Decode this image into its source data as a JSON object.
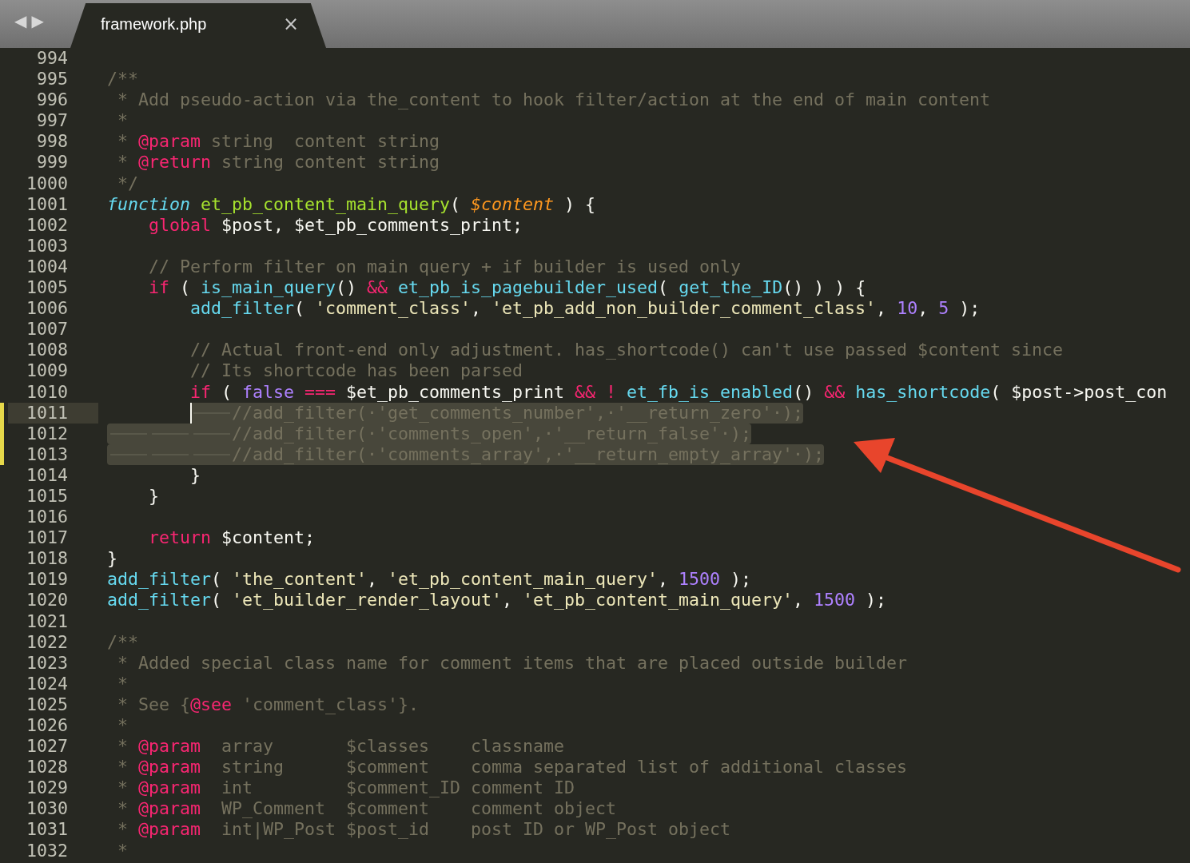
{
  "tab_bar": {
    "back": "◀",
    "forward": "▶",
    "tabs": [
      {
        "label": "framework.php",
        "close": "×",
        "selected": true
      }
    ]
  },
  "editor": {
    "lines": [
      {
        "number": "994",
        "current": false,
        "modified": false,
        "selected": false
      },
      {
        "number": "995",
        "current": false,
        "modified": false,
        "selected": false,
        "tokens": [
          {
            "kind": "comment",
            "text": "/**"
          }
        ]
      },
      {
        "number": "996",
        "current": false,
        "modified": false,
        "selected": false,
        "tokens": [
          {
            "kind": "comment",
            "text": " * Add pseudo-action via the_content to hook filter/action at the end of main content"
          }
        ]
      },
      {
        "number": "997",
        "current": false,
        "modified": false,
        "selected": false,
        "tokens": [
          {
            "kind": "comment",
            "text": " *"
          }
        ]
      },
      {
        "number": "998",
        "current": false,
        "modified": false,
        "selected": false,
        "tokens": [
          {
            "kind": "comment",
            "text": " * "
          },
          {
            "kind": "tag",
            "text": "@param"
          },
          {
            "kind": "comment",
            "text": " string  content string"
          }
        ]
      },
      {
        "number": "999",
        "current": false,
        "modified": false,
        "selected": false,
        "tokens": [
          {
            "kind": "comment",
            "text": " * "
          },
          {
            "kind": "tag",
            "text": "@return"
          },
          {
            "kind": "comment",
            "text": " string content string"
          }
        ]
      },
      {
        "number": "1000",
        "current": false,
        "modified": false,
        "selected": false,
        "tokens": [
          {
            "kind": "comment",
            "text": " */"
          }
        ]
      },
      {
        "number": "1001",
        "current": false,
        "modified": false,
        "selected": false,
        "tokens": [
          {
            "kind": "storage",
            "text": "function"
          },
          {
            "kind": "entity",
            "text": " et_pb_content_main_query"
          },
          {
            "kind": "plain",
            "text": "( "
          },
          {
            "kind": "param",
            "text": "$content"
          },
          {
            "kind": "plain",
            "text": " ) {"
          }
        ]
      },
      {
        "number": "1002",
        "current": false,
        "modified": false,
        "selected": false,
        "tokens": [
          {
            "kind": "keyword",
            "text": "\tglobal"
          },
          {
            "kind": "plain",
            "text": " $post, $et_pb_comments_print;"
          }
        ]
      },
      {
        "number": "1003",
        "current": false,
        "modified": false,
        "selected": false
      },
      {
        "number": "1004",
        "current": false,
        "modified": false,
        "selected": false,
        "tokens": [
          {
            "kind": "comment",
            "text": "\t// Perform filter on main query + if builder is used only"
          }
        ]
      },
      {
        "number": "1005",
        "current": false,
        "modified": false,
        "selected": false,
        "tokens": [
          {
            "kind": "keyword",
            "text": "\tif"
          },
          {
            "kind": "plain",
            "text": " ( "
          },
          {
            "kind": "call",
            "text": "is_main_query"
          },
          {
            "kind": "plain",
            "text": "() "
          },
          {
            "kind": "keyword",
            "text": "&&"
          },
          {
            "kind": "call",
            "text": " et_pb_is_pagebuilder_used"
          },
          {
            "kind": "plain",
            "text": "( "
          },
          {
            "kind": "call",
            "text": "get_the_ID"
          },
          {
            "kind": "plain",
            "text": "() ) ) {"
          }
        ]
      },
      {
        "number": "1006",
        "current": false,
        "modified": false,
        "selected": false,
        "tokens": [
          {
            "kind": "call",
            "text": "\t\tadd_filter"
          },
          {
            "kind": "plain",
            "text": "( "
          },
          {
            "kind": "string",
            "text": "'comment_class'"
          },
          {
            "kind": "plain",
            "text": ", "
          },
          {
            "kind": "string",
            "text": "'et_pb_add_non_builder_comment_class'"
          },
          {
            "kind": "plain",
            "text": ", "
          },
          {
            "kind": "number",
            "text": "10"
          },
          {
            "kind": "plain",
            "text": ", "
          },
          {
            "kind": "number",
            "text": "5"
          },
          {
            "kind": "plain",
            "text": " );"
          }
        ]
      },
      {
        "number": "1007",
        "current": false,
        "modified": false,
        "selected": false
      },
      {
        "number": "1008",
        "current": false,
        "modified": false,
        "selected": false,
        "tokens": [
          {
            "kind": "comment",
            "text": "\t\t// Actual front-end only adjustment. has_shortcode() can't use passed $content since"
          }
        ]
      },
      {
        "number": "1009",
        "current": false,
        "modified": false,
        "selected": false,
        "tokens": [
          {
            "kind": "comment",
            "text": "\t\t// Its shortcode has been parsed"
          }
        ]
      },
      {
        "number": "1010",
        "current": false,
        "modified": false,
        "selected": false,
        "tokens": [
          {
            "kind": "keyword",
            "text": "\t\tif"
          },
          {
            "kind": "plain",
            "text": " ( "
          },
          {
            "kind": "constant",
            "text": "false"
          },
          {
            "kind": "keyword",
            "text": " ==="
          },
          {
            "kind": "plain",
            "text": " $et_pb_comments_print "
          },
          {
            "kind": "keyword",
            "text": "&& !"
          },
          {
            "kind": "call",
            "text": " et_fb_is_enabled"
          },
          {
            "kind": "plain",
            "text": "() "
          },
          {
            "kind": "keyword",
            "text": "&&"
          },
          {
            "kind": "call",
            "text": " has_shortcode"
          },
          {
            "kind": "plain",
            "text": "( $post->post_con"
          }
        ]
      },
      {
        "number": "1011",
        "current": true,
        "modified": true,
        "selected": true,
        "tokens": [
          {
            "kind": "comment",
            "text": "\t\t\t//add_filter(·'get_comments_number',·'__return_zero'·);"
          }
        ]
      },
      {
        "number": "1012",
        "current": false,
        "modified": true,
        "selected": true,
        "tokens": [
          {
            "kind": "comment",
            "text": "\t\t\t//add_filter(·'comments_open',·'__return_false'·);"
          }
        ]
      },
      {
        "number": "1013",
        "current": false,
        "modified": true,
        "selected": true,
        "tokens": [
          {
            "kind": "comment",
            "text": "\t\t\t//add_filter(·'comments_array',·'__return_empty_array'·);"
          }
        ]
      },
      {
        "number": "1014",
        "current": false,
        "modified": false,
        "selected": false,
        "tokens": [
          {
            "kind": "plain",
            "text": "\t\t}"
          }
        ]
      },
      {
        "number": "1015",
        "current": false,
        "modified": false,
        "selected": false,
        "tokens": [
          {
            "kind": "plain",
            "text": "\t}"
          }
        ]
      },
      {
        "number": "1016",
        "current": false,
        "modified": false,
        "selected": false
      },
      {
        "number": "1017",
        "current": false,
        "modified": false,
        "selected": false,
        "tokens": [
          {
            "kind": "keyword",
            "text": "\treturn"
          },
          {
            "kind": "plain",
            "text": " $content;"
          }
        ]
      },
      {
        "number": "1018",
        "current": false,
        "modified": false,
        "selected": false,
        "tokens": [
          {
            "kind": "plain",
            "text": "}"
          }
        ]
      },
      {
        "number": "1019",
        "current": false,
        "modified": false,
        "selected": false,
        "tokens": [
          {
            "kind": "call",
            "text": "add_filter"
          },
          {
            "kind": "plain",
            "text": "( "
          },
          {
            "kind": "string",
            "text": "'the_content'"
          },
          {
            "kind": "plain",
            "text": ", "
          },
          {
            "kind": "string",
            "text": "'et_pb_content_main_query'"
          },
          {
            "kind": "plain",
            "text": ", "
          },
          {
            "kind": "number",
            "text": "1500"
          },
          {
            "kind": "plain",
            "text": " );"
          }
        ]
      },
      {
        "number": "1020",
        "current": false,
        "modified": false,
        "selected": false,
        "tokens": [
          {
            "kind": "call",
            "text": "add_filter"
          },
          {
            "kind": "plain",
            "text": "( "
          },
          {
            "kind": "string",
            "text": "'et_builder_render_layout'"
          },
          {
            "kind": "plain",
            "text": ", "
          },
          {
            "kind": "string",
            "text": "'et_pb_content_main_query'"
          },
          {
            "kind": "plain",
            "text": ", "
          },
          {
            "kind": "number",
            "text": "1500"
          },
          {
            "kind": "plain",
            "text": " );"
          }
        ]
      },
      {
        "number": "1021",
        "current": false,
        "modified": false,
        "selected": false
      },
      {
        "number": "1022",
        "current": false,
        "modified": false,
        "selected": false,
        "tokens": [
          {
            "kind": "comment",
            "text": "/**"
          }
        ]
      },
      {
        "number": "1023",
        "current": false,
        "modified": false,
        "selected": false,
        "tokens": [
          {
            "kind": "comment",
            "text": " * Added special class name for comment items that are placed outside builder"
          }
        ]
      },
      {
        "number": "1024",
        "current": false,
        "modified": false,
        "selected": false,
        "tokens": [
          {
            "kind": "comment",
            "text": " *"
          }
        ]
      },
      {
        "number": "1025",
        "current": false,
        "modified": false,
        "selected": false,
        "tokens": [
          {
            "kind": "comment",
            "text": " * See {"
          },
          {
            "kind": "tag",
            "text": "@see"
          },
          {
            "kind": "comment",
            "text": " 'comment_class'}."
          }
        ]
      },
      {
        "number": "1026",
        "current": false,
        "modified": false,
        "selected": false,
        "tokens": [
          {
            "kind": "comment",
            "text": " *"
          }
        ]
      },
      {
        "number": "1027",
        "current": false,
        "modified": false,
        "selected": false,
        "tokens": [
          {
            "kind": "comment",
            "text": " * "
          },
          {
            "kind": "tag",
            "text": "@param"
          },
          {
            "kind": "comment",
            "text": "  array       $classes    classname"
          }
        ]
      },
      {
        "number": "1028",
        "current": false,
        "modified": false,
        "selected": false,
        "tokens": [
          {
            "kind": "comment",
            "text": " * "
          },
          {
            "kind": "tag",
            "text": "@param"
          },
          {
            "kind": "comment",
            "text": "  string      $comment    comma separated list of additional classes"
          }
        ]
      },
      {
        "number": "1029",
        "current": false,
        "modified": false,
        "selected": false,
        "tokens": [
          {
            "kind": "comment",
            "text": " * "
          },
          {
            "kind": "tag",
            "text": "@param"
          },
          {
            "kind": "comment",
            "text": "  int         $comment_ID comment ID"
          }
        ]
      },
      {
        "number": "1030",
        "current": false,
        "modified": false,
        "selected": false,
        "tokens": [
          {
            "kind": "comment",
            "text": " * "
          },
          {
            "kind": "tag",
            "text": "@param"
          },
          {
            "kind": "comment",
            "text": "  WP_Comment  $comment    comment object"
          }
        ]
      },
      {
        "number": "1031",
        "current": false,
        "modified": false,
        "selected": false,
        "tokens": [
          {
            "kind": "comment",
            "text": " * "
          },
          {
            "kind": "tag",
            "text": "@param"
          },
          {
            "kind": "comment",
            "text": "  int|WP_Post $post_id    post ID or WP_Post object"
          }
        ]
      },
      {
        "number": "1032",
        "current": false,
        "modified": false,
        "selected": false,
        "tokens": [
          {
            "kind": "comment",
            "text": " *"
          }
        ]
      }
    ]
  },
  "annotation": {
    "kind": "arrow"
  }
}
